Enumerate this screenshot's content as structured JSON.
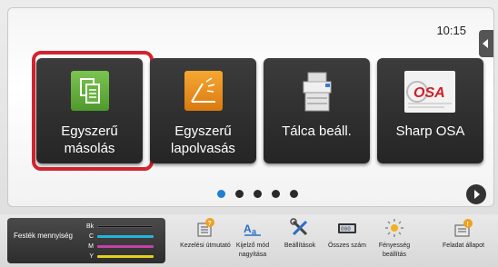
{
  "status": {
    "time": "10:15"
  },
  "tiles": [
    {
      "label": "Egyszerű másolás",
      "selected": true,
      "icon": "copy-icon",
      "color": "#5daa3a"
    },
    {
      "label": "Egyszerű lapolvasás",
      "selected": false,
      "icon": "scan-icon",
      "color": "#e98c1d"
    },
    {
      "label": "Tálca beáll.",
      "selected": false,
      "icon": "printer-tray-icon",
      "color": "#d8d8d8"
    },
    {
      "label": "Sharp OSA",
      "selected": false,
      "icon": "osa-logo-icon",
      "color": "#e8e8e8"
    }
  ],
  "pager": {
    "pages": 5,
    "current": 1
  },
  "toner": {
    "title": "Festék mennyiség",
    "channels": [
      {
        "name": "Bk",
        "color": "#111111"
      },
      {
        "name": "C",
        "color": "#22b5d8"
      },
      {
        "name": "M",
        "color": "#c640a8"
      },
      {
        "name": "Y",
        "color": "#e3d21c"
      }
    ]
  },
  "bottom_functions": [
    {
      "label": "Kezelési útmutató",
      "icon": "manual-icon"
    },
    {
      "label": "Kijelző mód nagyítása",
      "icon": "zoom-display-icon"
    },
    {
      "label": "Beállítások",
      "icon": "settings-tools-icon"
    },
    {
      "label": "Összes szám",
      "icon": "counter-icon"
    },
    {
      "label": "Fényesség beállítás",
      "icon": "brightness-icon"
    },
    {
      "label": "Feladat állapot",
      "icon": "job-status-icon"
    }
  ],
  "colors": {
    "selection": "#d3232f",
    "pager_active": "#1f7fd0"
  }
}
